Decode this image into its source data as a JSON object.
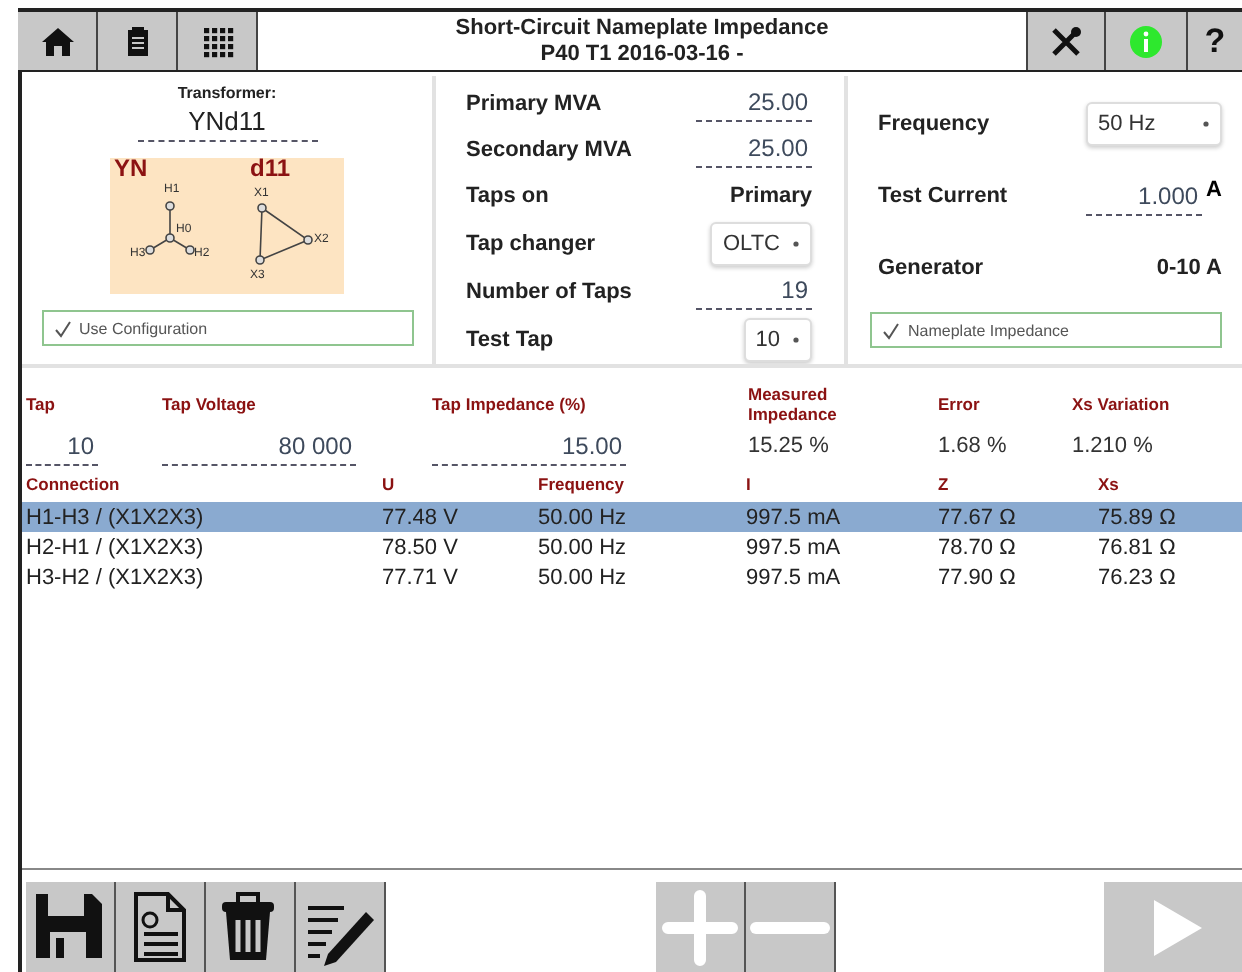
{
  "header": {
    "title": "Short-Circuit Nameplate Impedance",
    "subtitle": "P40 T1 2016-03-16 -",
    "help_label": "?"
  },
  "transformer": {
    "label": "Transformer:",
    "vector_group": "YNd11",
    "primary_winding": "YN",
    "secondary_winding": "d11",
    "primary_nodes": [
      "H1",
      "H0",
      "H3",
      "H2"
    ],
    "secondary_nodes": [
      "X1",
      "X2",
      "X3"
    ],
    "use_configuration": {
      "label": "Use Configuration",
      "checked": true
    }
  },
  "ratings": [
    {
      "kind": "input",
      "label": "Primary MVA",
      "value": "25.00"
    },
    {
      "kind": "input",
      "label": "Secondary MVA",
      "value": "25.00"
    },
    {
      "kind": "text",
      "label": "Taps on",
      "value": "Primary"
    },
    {
      "kind": "select",
      "label": "Tap changer",
      "value": "OLTC"
    },
    {
      "kind": "input",
      "label": "Number of Taps",
      "value": "19"
    },
    {
      "kind": "select",
      "label": "Test Tap",
      "value": "10"
    }
  ],
  "test_settings": [
    {
      "kind": "select",
      "label": "Frequency",
      "value": "50 Hz"
    },
    {
      "kind": "input",
      "label": "Test Current",
      "value": "1.000",
      "unit": "A"
    },
    {
      "kind": "text",
      "label": "Generator",
      "value": "0-10 A"
    }
  ],
  "nameplate_impedance": {
    "label": "Nameplate Impedance",
    "checked": true
  },
  "summary": [
    {
      "kind": "input",
      "label": "Tap",
      "value": "10"
    },
    {
      "kind": "input",
      "label": "Tap Voltage",
      "value": "80 000"
    },
    {
      "kind": "input",
      "label": "Tap Impedance (%)",
      "value": "15.00"
    },
    {
      "kind": "text",
      "label": "Measured Impedance",
      "value": "15.25 %"
    },
    {
      "kind": "text",
      "label": "Error",
      "value": "1.68 %"
    },
    {
      "kind": "text",
      "label": "Xs Variation",
      "value": "1.210 %"
    }
  ],
  "measurements": {
    "columns": [
      "Connection",
      "U",
      "Frequency",
      "I",
      "Z",
      "Xs"
    ],
    "rows": [
      {
        "cells": [
          "H1-H3 / (X1X2X3)",
          "77.48 V",
          "50.00 Hz",
          "997.5 mA",
          "77.67 Ω",
          "75.89 Ω"
        ],
        "selected": true
      },
      {
        "cells": [
          "H2-H1 / (X1X2X3)",
          "78.50 V",
          "50.00 Hz",
          "997.5 mA",
          "78.70 Ω",
          "76.81 Ω"
        ],
        "selected": false
      },
      {
        "cells": [
          "H3-H2 / (X1X2X3)",
          "77.71 V",
          "50.00 Hz",
          "997.5 mA",
          "77.90 Ω",
          "76.23 Ω"
        ],
        "selected": false
      }
    ]
  },
  "bottom_bar": [
    {
      "kind": "save",
      "disabled": false
    },
    {
      "kind": "report",
      "disabled": false
    },
    {
      "kind": "delete",
      "disabled": false
    },
    {
      "kind": "edit",
      "disabled": false
    },
    {
      "kind": "spacer"
    },
    {
      "kind": "add",
      "disabled": true
    },
    {
      "kind": "remove",
      "disabled": true
    },
    {
      "kind": "spacer"
    },
    {
      "kind": "start",
      "disabled": true
    }
  ]
}
